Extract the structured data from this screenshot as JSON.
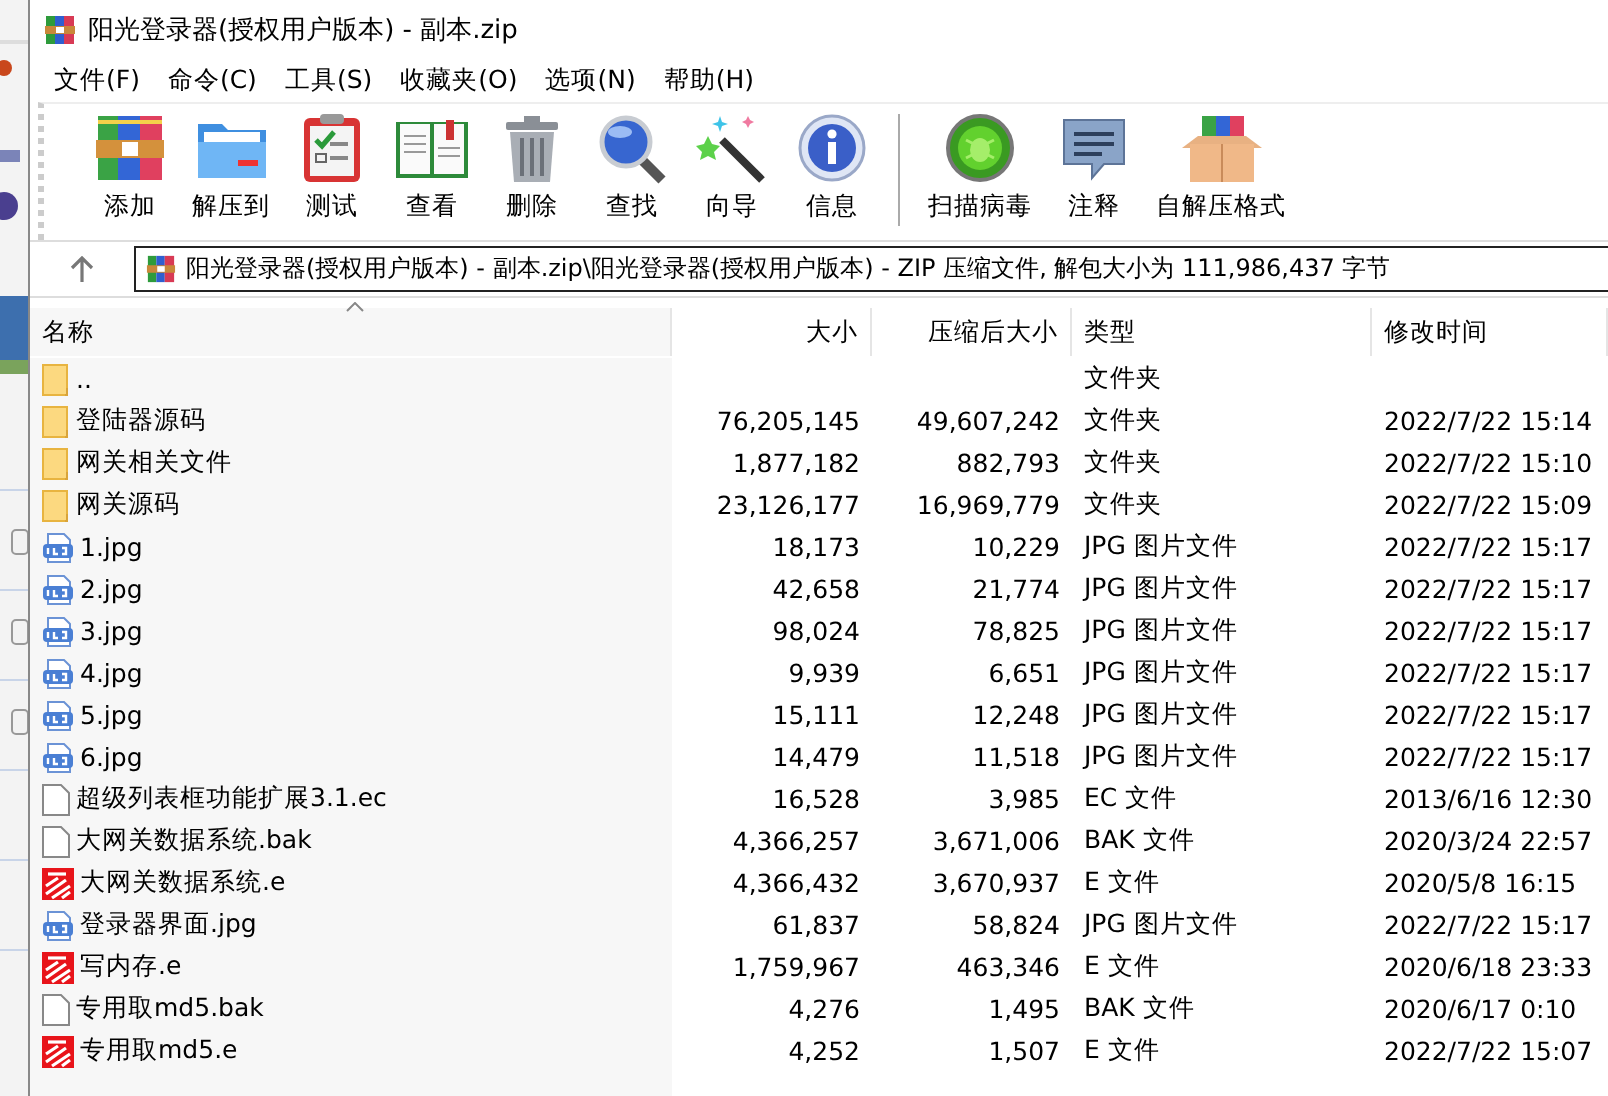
{
  "window": {
    "title": "阳光登录器(授权用户版本) - 副本.zip"
  },
  "menu": [
    "文件(F)",
    "命令(C)",
    "工具(S)",
    "收藏夹(O)",
    "选项(N)",
    "帮助(H)"
  ],
  "toolbar": {
    "groups": [
      [
        {
          "kind": "add",
          "label": "添加"
        },
        {
          "kind": "extract",
          "label": "解压到"
        },
        {
          "kind": "test",
          "label": "测试"
        },
        {
          "kind": "view",
          "label": "查看"
        },
        {
          "kind": "delete",
          "label": "删除"
        },
        {
          "kind": "find",
          "label": "查找"
        },
        {
          "kind": "wizard",
          "label": "向导"
        },
        {
          "kind": "info",
          "label": "信息"
        }
      ],
      [
        {
          "kind": "virus",
          "label": "扫描病毒"
        },
        {
          "kind": "comment",
          "label": "注释"
        },
        {
          "kind": "sfx",
          "label": "自解压格式"
        }
      ]
    ]
  },
  "address": "阳光登录器(授权用户版本) - 副本.zip\\阳光登录器(授权用户版本) - ZIP 压缩文件, 解包大小为 111,986,437 字节",
  "table": {
    "columns": [
      "名称",
      "大小",
      "压缩后大小",
      "类型",
      "修改时间"
    ],
    "rows": [
      {
        "kind": "folder",
        "name": "..",
        "type": "文件夹"
      },
      {
        "kind": "folder",
        "name": "登陆器源码",
        "size": "76,205,145",
        "packed": "49,607,242",
        "type": "文件夹",
        "modified": "2022/7/22 15:14"
      },
      {
        "kind": "folder",
        "name": "网关相关文件",
        "size": "1,877,182",
        "packed": "882,793",
        "type": "文件夹",
        "modified": "2022/7/22 15:10"
      },
      {
        "kind": "folder",
        "name": "网关源码",
        "size": "23,126,177",
        "packed": "16,969,779",
        "type": "文件夹",
        "modified": "2022/7/22 15:09"
      },
      {
        "kind": "jpg",
        "name": "1.jpg",
        "size": "18,173",
        "packed": "10,229",
        "type": "JPG 图片文件",
        "modified": "2022/7/22 15:17"
      },
      {
        "kind": "jpg",
        "name": "2.jpg",
        "size": "42,658",
        "packed": "21,774",
        "type": "JPG 图片文件",
        "modified": "2022/7/22 15:17"
      },
      {
        "kind": "jpg",
        "name": "3.jpg",
        "size": "98,024",
        "packed": "78,825",
        "type": "JPG 图片文件",
        "modified": "2022/7/22 15:17"
      },
      {
        "kind": "jpg",
        "name": "4.jpg",
        "size": "9,939",
        "packed": "6,651",
        "type": "JPG 图片文件",
        "modified": "2022/7/22 15:17"
      },
      {
        "kind": "jpg",
        "name": "5.jpg",
        "size": "15,111",
        "packed": "12,248",
        "type": "JPG 图片文件",
        "modified": "2022/7/22 15:17"
      },
      {
        "kind": "jpg",
        "name": "6.jpg",
        "size": "14,479",
        "packed": "11,518",
        "type": "JPG 图片文件",
        "modified": "2022/7/22 15:17"
      },
      {
        "kind": "file",
        "name": "超级列表框功能扩展3.1.ec",
        "size": "16,528",
        "packed": "3,985",
        "type": "EC 文件",
        "modified": "2013/6/16 12:30"
      },
      {
        "kind": "file",
        "name": "大网关数据系统.bak",
        "size": "4,366,257",
        "packed": "3,671,006",
        "type": "BAK 文件",
        "modified": "2020/3/24 22:57"
      },
      {
        "kind": "e",
        "name": "大网关数据系统.e",
        "size": "4,366,432",
        "packed": "3,670,937",
        "type": "E 文件",
        "modified": "2020/5/8 16:15"
      },
      {
        "kind": "jpg",
        "name": "登录器界面.jpg",
        "size": "61,837",
        "packed": "58,824",
        "type": "JPG 图片文件",
        "modified": "2022/7/22 15:17"
      },
      {
        "kind": "e",
        "name": "写内存.e",
        "size": "1,759,967",
        "packed": "463,346",
        "type": "E 文件",
        "modified": "2020/6/18 23:33"
      },
      {
        "kind": "file",
        "name": "专用取md5.bak",
        "size": "4,276",
        "packed": "1,495",
        "type": "BAK 文件",
        "modified": "2020/6/17 0:10"
      },
      {
        "kind": "e",
        "name": "专用取md5.e",
        "size": "4,252",
        "packed": "1,507",
        "type": "E 文件",
        "modified": "2022/7/22 15:07"
      }
    ]
  }
}
